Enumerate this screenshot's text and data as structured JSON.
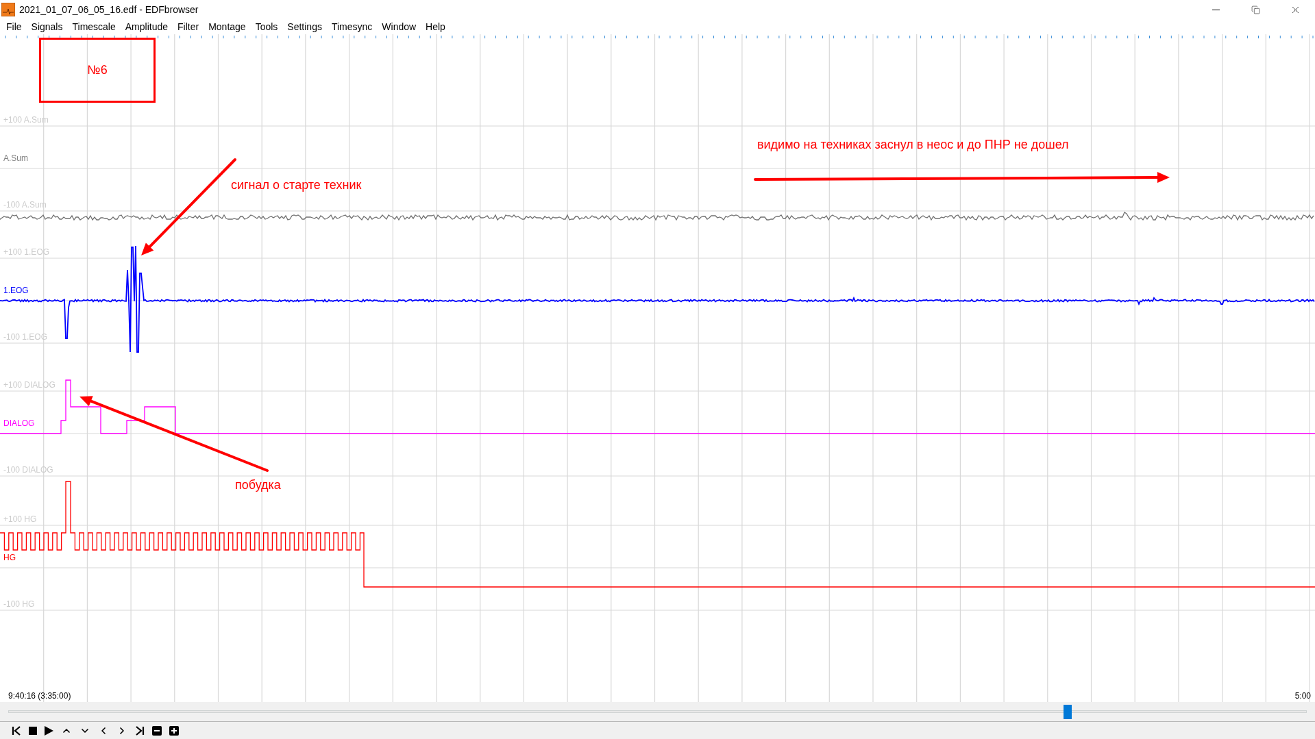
{
  "window": {
    "title": "2021_01_07_06_05_16.edf - EDFbrowser"
  },
  "menu": [
    "File",
    "Signals",
    "Timescale",
    "Amplitude",
    "Filter",
    "Montage",
    "Tools",
    "Settings",
    "Timesync",
    "Window",
    "Help"
  ],
  "signals": [
    {
      "name": "A.Sum",
      "upper": "+100 A.Sum",
      "lower": "-100 A.Sum",
      "color": "#808080",
      "kind": "noise"
    },
    {
      "name": "1.EOG",
      "upper": "+100 1.EOG",
      "lower": "-100 1.EOG",
      "color": "#0000ff",
      "kind": "eog"
    },
    {
      "name": "DIALOG",
      "upper": "+100 DIALOG",
      "lower": "-100 DIALOG",
      "color": "#ff00ff",
      "kind": "steps"
    },
    {
      "name": "HG",
      "upper": "+100 HG",
      "lower": "-100 HG",
      "color": "#ff0000",
      "kind": "pulses"
    }
  ],
  "annotations": [
    {
      "kind": "box",
      "text": "№6"
    },
    {
      "kind": "arrow-down-left",
      "text": "сигнал о старте техник"
    },
    {
      "kind": "arrow-right",
      "text": "видимо на техниках заснул в неос и до ПНР не дошел"
    },
    {
      "kind": "arrow-up-left",
      "text": "побудка"
    }
  ],
  "timeline": {
    "start": "9:40:16 (3:35:00)",
    "end": "5:00",
    "level": 0.816
  }
}
